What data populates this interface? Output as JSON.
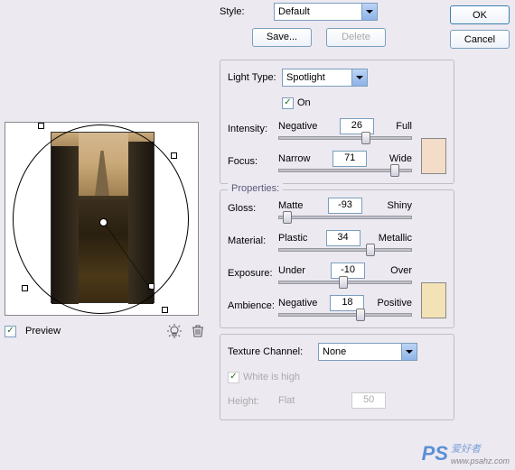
{
  "style": {
    "label": "Style:",
    "value": "Default",
    "save": "Save...",
    "delete": "Delete"
  },
  "buttons": {
    "ok": "OK",
    "cancel": "Cancel"
  },
  "light": {
    "type_label": "Light Type:",
    "type_value": "Spotlight",
    "on_label": "On"
  },
  "intensity": {
    "label": "Intensity:",
    "left": "Negative",
    "right": "Full",
    "value": "26"
  },
  "focus": {
    "label": "Focus:",
    "left": "Narrow",
    "right": "Wide",
    "value": "71"
  },
  "properties_title": "Properties:",
  "gloss": {
    "label": "Gloss:",
    "left": "Matte",
    "right": "Shiny",
    "value": "-93"
  },
  "material": {
    "label": "Material:",
    "left": "Plastic",
    "right": "Metallic",
    "value": "34"
  },
  "exposure": {
    "label": "Exposure:",
    "left": "Under",
    "right": "Over",
    "value": "-10"
  },
  "ambience": {
    "label": "Ambience:",
    "left": "Negative",
    "right": "Positive",
    "value": "18"
  },
  "texture": {
    "label": "Texture Channel:",
    "value": "None",
    "white_label": "White is high",
    "height_label": "Height:",
    "height_left": "Flat",
    "height_value": "50"
  },
  "preview": {
    "label": "Preview"
  },
  "colors": {
    "light_swatch": "#f3dcc8",
    "ambient_swatch": "#f2e2b5"
  },
  "watermark": {
    "brand": "PS",
    "text": "爱好者",
    "url": "www.psahz.com"
  }
}
